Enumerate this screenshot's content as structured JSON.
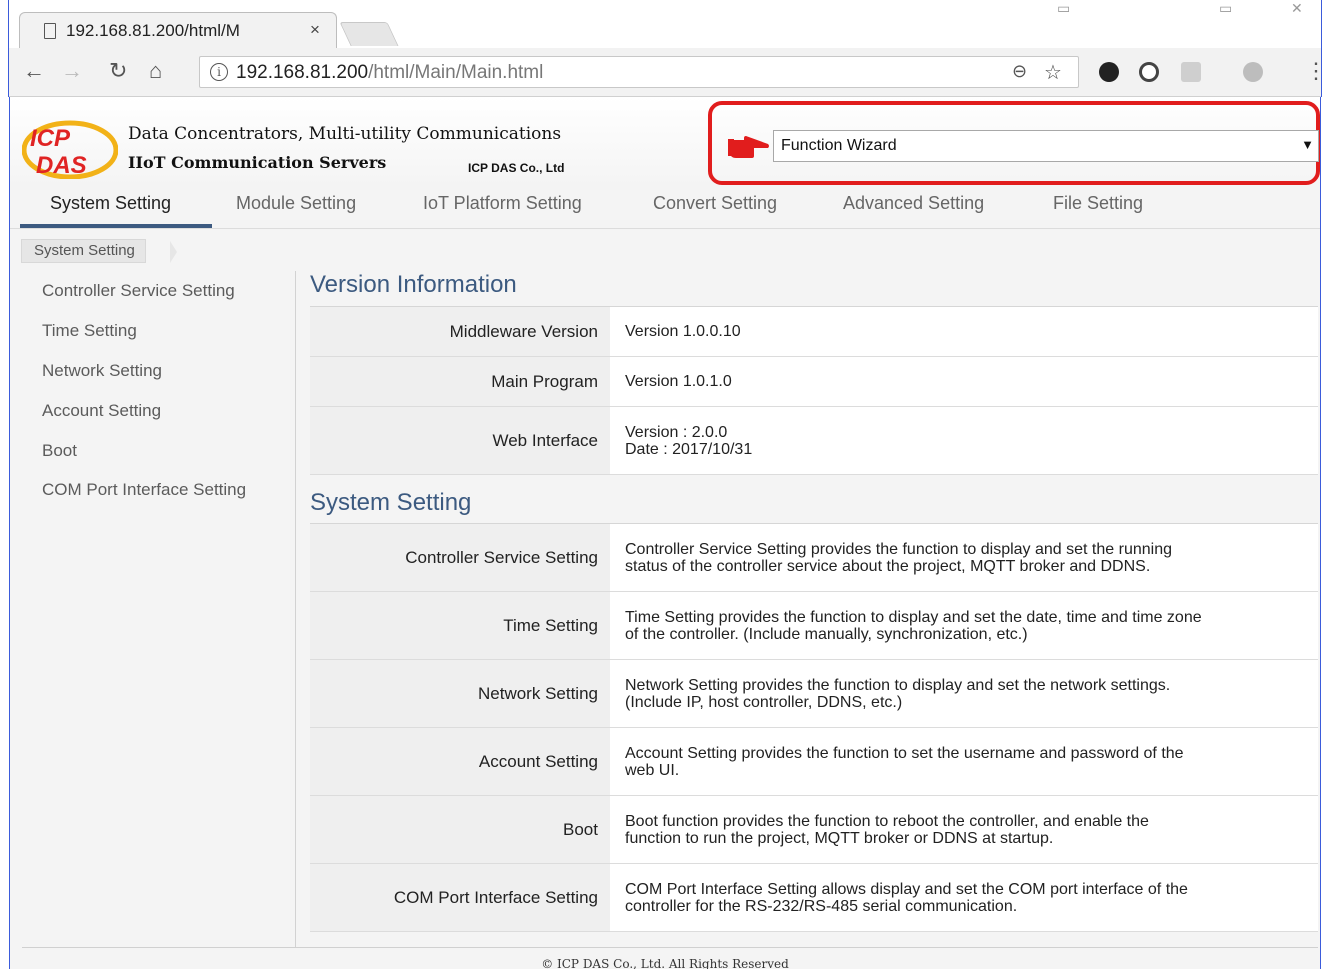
{
  "browser": {
    "tab_title": "192.168.81.200/html/M",
    "tab_close": "×",
    "url_host": "192.168.81.200",
    "url_path": "/html/Main/Main.html"
  },
  "header": {
    "logo_text": "ICP DAS",
    "line1": "Data Concentrators, Multi-utility Communications",
    "line2": "IIoT Communication Servers",
    "company": "ICP DAS Co., Ltd",
    "accent_color": "#3c5a80",
    "highlight_color": "#e11d1d"
  },
  "wizard": {
    "selected": "Function Wizard"
  },
  "mainnav": {
    "tabs": [
      {
        "label": "System Setting",
        "active": true
      },
      {
        "label": "Module Setting"
      },
      {
        "label": "IoT Platform Setting"
      },
      {
        "label": "Convert Setting"
      },
      {
        "label": "Advanced Setting"
      },
      {
        "label": "File Setting"
      }
    ]
  },
  "breadcrumb": "System Setting",
  "sidebar": {
    "items": [
      {
        "label": "Controller Service Setting"
      },
      {
        "label": "Time Setting"
      },
      {
        "label": "Network Setting"
      },
      {
        "label": "Account Setting"
      },
      {
        "label": "Boot"
      },
      {
        "label": "COM Port Interface Setting"
      }
    ]
  },
  "version": {
    "title": "Version Information",
    "rows": [
      {
        "label": "Middleware Version",
        "value": "Version 1.0.0.10"
      },
      {
        "label": "Main Program",
        "value": "Version 1.0.1.0"
      },
      {
        "label": "Web Interface",
        "value": "Version : 2.0.0",
        "value2": "Date : 2017/10/31"
      }
    ]
  },
  "system": {
    "title": "System Setting",
    "rows": [
      {
        "label": "Controller Service Setting",
        "value": "Controller Service Setting provides the function to display and set the running",
        "value2": "status of the controller service about the project, MQTT broker and DDNS."
      },
      {
        "label": "Time Setting",
        "value": "Time Setting provides the function to display and set the date, time and time zone",
        "value2": "of the controller. (Include manually, synchronization, etc.)"
      },
      {
        "label": "Network Setting",
        "value": "Network Setting provides the function to display and set the network settings.",
        "value2": "(Include IP, host controller, DDNS, etc.)"
      },
      {
        "label": "Account Setting",
        "value": "Account Setting provides the function to set the username and password of the",
        "value2": "web UI."
      },
      {
        "label": "Boot",
        "value": "Boot function provides the function to reboot the controller, and enable the",
        "value2": "function to run the project, MQTT broker or DDNS at startup."
      },
      {
        "label": "COM Port Interface Setting",
        "value": "COM Port Interface Setting allows display and set the COM port interface of the",
        "value2": "controller for the RS-232/RS-485 serial communication."
      }
    ]
  },
  "footer": "© ICP DAS Co., Ltd. All Rights Reserved"
}
